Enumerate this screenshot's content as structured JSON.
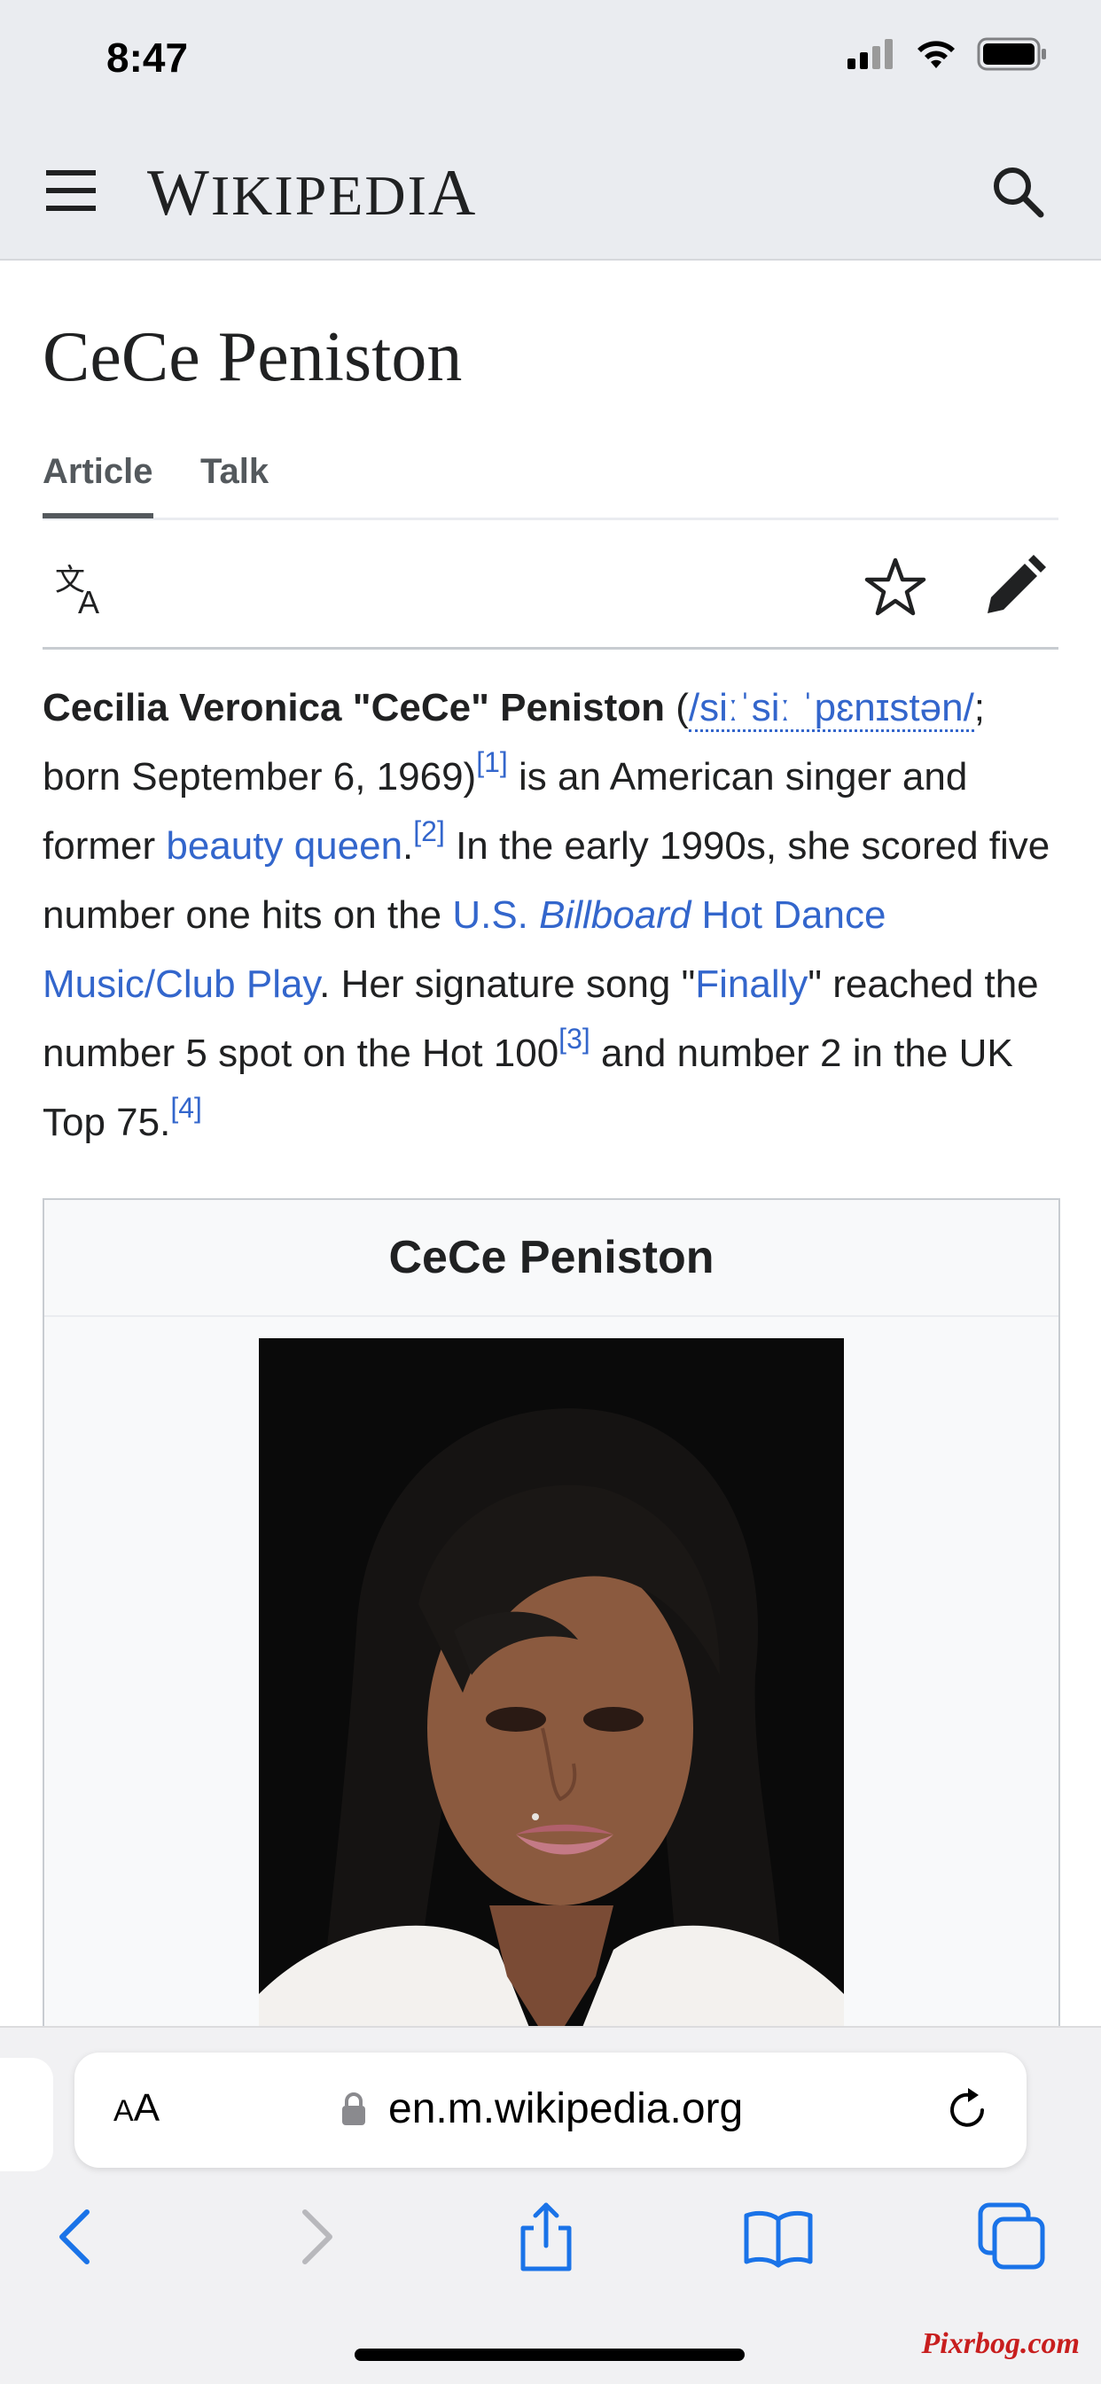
{
  "status_bar": {
    "time": "8:47"
  },
  "header": {
    "wordmark_first": "W",
    "wordmark_mid": "IKIPEDI",
    "wordmark_last": "A"
  },
  "page": {
    "title": "CeCe Peniston"
  },
  "tabs": [
    {
      "label": "Article",
      "active": true
    },
    {
      "label": "Talk",
      "active": false
    }
  ],
  "intro": {
    "bold_name": "Cecilia Veronica \"CeCe\" Peniston",
    "open_paren": " (",
    "ipa": "/siːˈsiː ˈpɛnɪstən/",
    "born": "; born September 6, 1969)",
    "ref1": "[1]",
    "text2": " is an American singer and former ",
    "link_beauty": "beauty queen",
    "period1": ".",
    "ref2": "[2]",
    "text3": " In the early 1990s, she scored five number one hits on the ",
    "link_us": "U.S. ",
    "link_billboard": "Billboard",
    "link_chart": " Hot Dance Music/Club Play",
    "text4": ". Her signature song \"",
    "link_finally": "Finally",
    "text5": "\" reached the number 5 spot on the Hot 100",
    "ref3": "[3]",
    "text6": " and number 2 in the UK Top 75.",
    "ref4": "[4]"
  },
  "infobox": {
    "title": "CeCe Peniston"
  },
  "safari": {
    "aa_small": "A",
    "aa_big": "A",
    "url": "en.m.wikipedia.org"
  },
  "watermark": "Pixrbog.com",
  "colors": {
    "link": "#3366cc",
    "chrome": "#eaecf0",
    "safari_icon": "#1a73e8"
  }
}
